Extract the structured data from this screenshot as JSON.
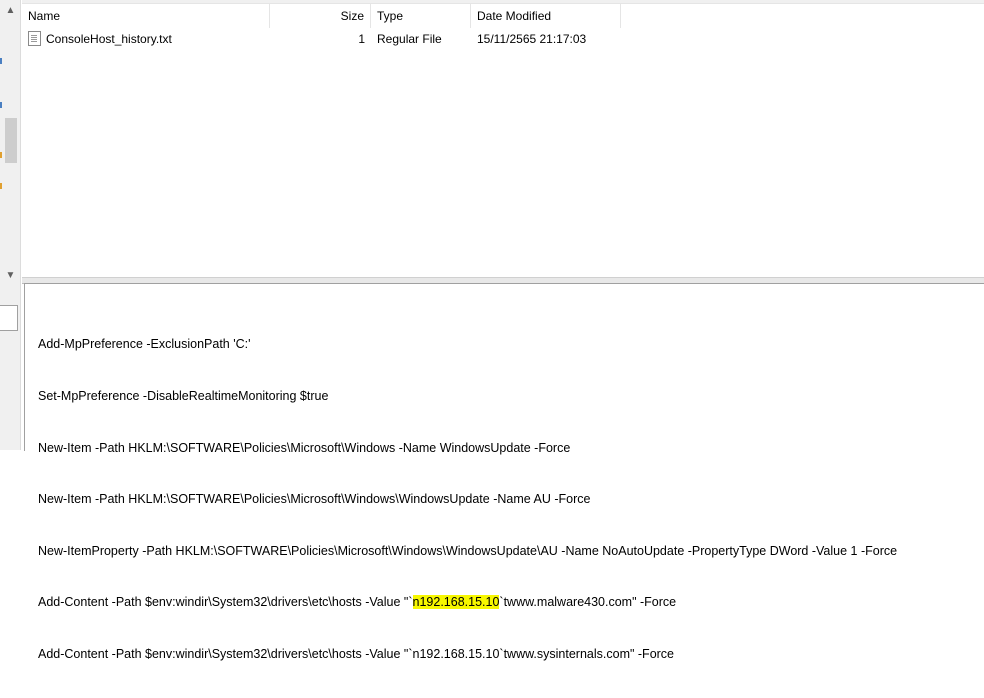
{
  "file_list": {
    "columns": {
      "name": "Name",
      "size": "Size",
      "type": "Type",
      "date": "Date Modified"
    },
    "rows": [
      {
        "name": "ConsoleHost_history.txt",
        "size": "1",
        "type": "Regular File",
        "date": "15/11/2565 21:17:03",
        "icon": "text-file-icon"
      }
    ]
  },
  "left_scrollbar": {
    "up_arrow": "▲",
    "down_arrow": "▼"
  },
  "text_view": {
    "lines": [
      {
        "text": "Add-MpPreference -ExclusionPath 'C:'"
      },
      {
        "text": "Set-MpPreference -DisableRealtimeMonitoring $true"
      },
      {
        "text": "New-Item -Path HKLM:\\SOFTWARE\\Policies\\Microsoft\\Windows -Name WindowsUpdate -Force"
      },
      {
        "text": "New-Item -Path HKLM:\\SOFTWARE\\Policies\\Microsoft\\Windows\\WindowsUpdate -Name AU -Force"
      },
      {
        "text": "New-ItemProperty -Path HKLM:\\SOFTWARE\\Policies\\Microsoft\\Windows\\WindowsUpdate\\AU -Name NoAutoUpdate -PropertyType DWord -Value 1 -Force"
      },
      {
        "pre": "Add-Content -Path $env:windir\\System32\\drivers\\etc\\hosts -Value \"`",
        "highlight": "n192.168.15.10",
        "post": "`twww.malware430.com\" -Force"
      },
      {
        "text": "Add-Content -Path $env:windir\\System32\\drivers\\etc\\hosts -Value \"`n192.168.15.10`twww.sysinternals.com\" -Force"
      }
    ],
    "highlight_color": "#f7f700"
  }
}
